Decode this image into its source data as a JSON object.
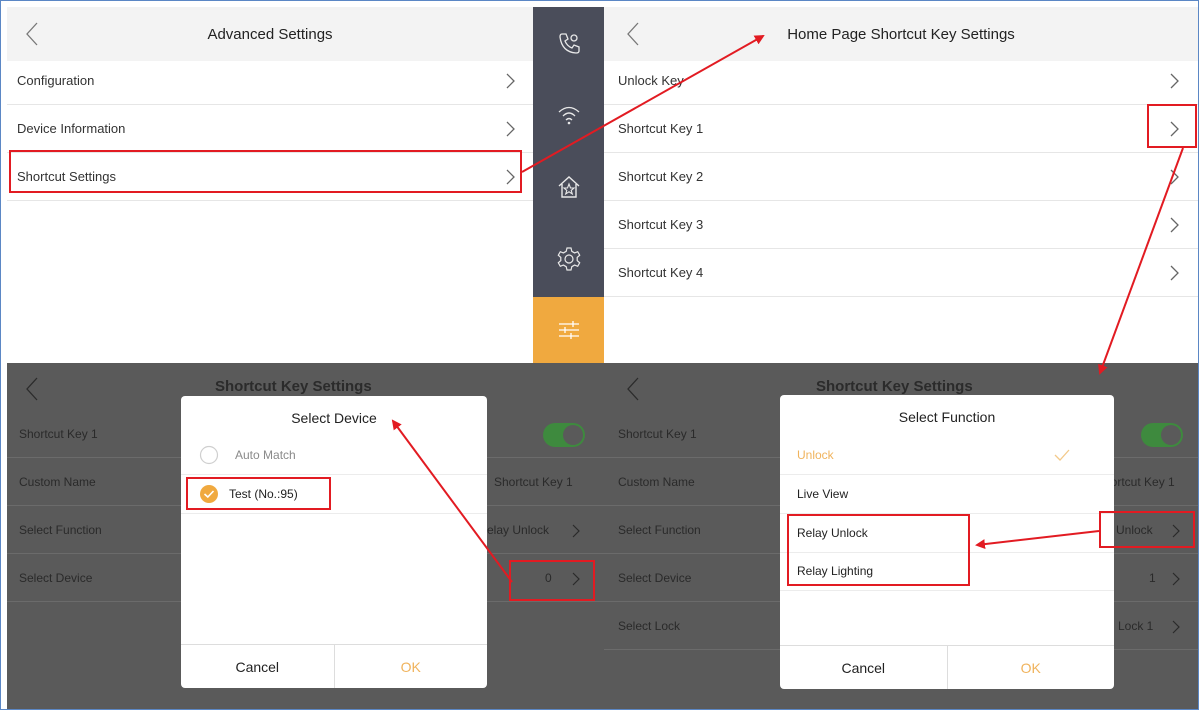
{
  "advanced": {
    "title": "Advanced Settings",
    "items": [
      {
        "label": "Configuration"
      },
      {
        "label": "Device Information"
      },
      {
        "label": "Shortcut Settings"
      }
    ]
  },
  "sidebar": {
    "icons": [
      "call-settings-icon",
      "wifi-icon",
      "home-icon",
      "gear-icon",
      "sliders-icon"
    ],
    "active_color": "#f0a93f"
  },
  "home_shortcut": {
    "title": "Home Page Shortcut Key Settings",
    "items": [
      {
        "label": "Unlock Key"
      },
      {
        "label": "Shortcut Key 1"
      },
      {
        "label": "Shortcut Key 2"
      },
      {
        "label": "Shortcut Key 3"
      },
      {
        "label": "Shortcut Key 4"
      }
    ]
  },
  "shortcut_left": {
    "title": "Shortcut Key Settings",
    "rows": [
      {
        "label": "Shortcut Key 1",
        "value": ""
      },
      {
        "label": "Custom Name",
        "value": "Shortcut Key 1"
      },
      {
        "label": "Select Function",
        "value": "elay Unlock"
      },
      {
        "label": "Select Device",
        "value": "0"
      }
    ],
    "dialog": {
      "title": "Select Device",
      "options": [
        {
          "label": "Auto Match",
          "selected": false
        },
        {
          "label": "Test (No.:95)",
          "selected": true
        }
      ],
      "cancel": "Cancel",
      "ok": "OK"
    }
  },
  "shortcut_right": {
    "title": "Shortcut Key Settings",
    "rows": [
      {
        "label": "Shortcut Key 1",
        "value": ""
      },
      {
        "label": "Custom Name",
        "value": "Shortcut Key 1"
      },
      {
        "label": "Select Function",
        "value": "Unlock"
      },
      {
        "label": "Select Device",
        "value": "1"
      },
      {
        "label": "Select Lock",
        "value": "Lock 1"
      }
    ],
    "dialog": {
      "title": "Select Function",
      "options": [
        {
          "label": "Unlock",
          "selected": true
        },
        {
          "label": "Live View",
          "selected": false
        },
        {
          "label": "Relay Unlock",
          "selected": false
        },
        {
          "label": "Relay Lighting",
          "selected": false
        }
      ],
      "cancel": "Cancel",
      "ok": "OK"
    }
  },
  "colors": {
    "accent": "#f0a93f",
    "highlight": "#e21b22",
    "toggle_on": "#3e8a3e"
  }
}
